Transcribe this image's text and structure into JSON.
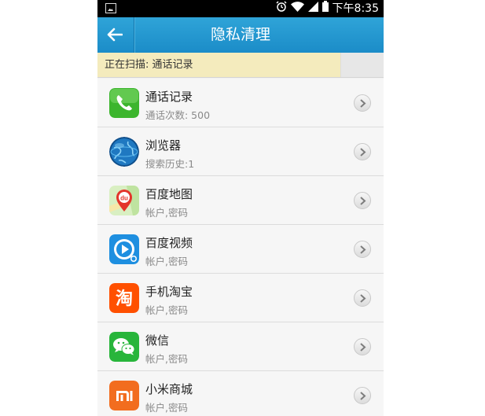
{
  "status_bar": {
    "time": "下午8:35",
    "icons": [
      "picture-icon",
      "alarm-icon",
      "wifi-icon",
      "signal-icon",
      "battery-icon"
    ]
  },
  "header": {
    "title": "隐私清理",
    "back_icon": "back-arrow-icon"
  },
  "scan": {
    "text": "正在扫描: 通话记录",
    "progress": 0.85
  },
  "items": [
    {
      "name": "通话记录",
      "detail": "通话次数: 500",
      "icon": "phone-icon"
    },
    {
      "name": "浏览器",
      "detail": "搜索历史:1",
      "icon": "browser-globe-icon"
    },
    {
      "name": "百度地图",
      "detail": "帐户,密码",
      "icon": "baidu-map-icon"
    },
    {
      "name": "百度视频",
      "detail": "帐户,密码",
      "icon": "baidu-video-icon"
    },
    {
      "name": "手机淘宝",
      "detail": "帐户,密码",
      "icon": "taobao-icon"
    },
    {
      "name": "微信",
      "detail": "帐户,密码",
      "icon": "wechat-icon"
    },
    {
      "name": "小米商城",
      "detail": "帐户,密码",
      "icon": "mi-store-icon"
    }
  ],
  "colors": {
    "header": "#1b8cc8",
    "scan_fill": "#f4ebbd"
  }
}
